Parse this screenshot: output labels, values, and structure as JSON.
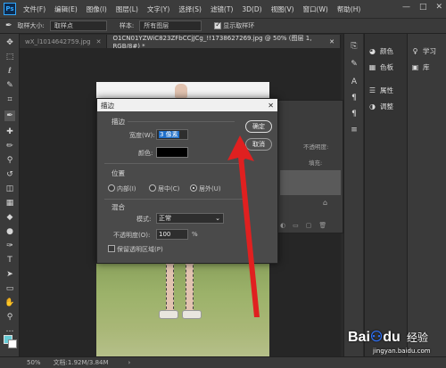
{
  "app": {
    "logo_text": "Ps"
  },
  "menubar": {
    "items": [
      "文件(F)",
      "编辑(E)",
      "图像(I)",
      "图层(L)",
      "文字(Y)",
      "选择(S)",
      "滤镜(T)",
      "3D(D)",
      "视图(V)",
      "窗口(W)",
      "帮助(H)"
    ],
    "window_buttons": [
      "—",
      "□",
      "✕"
    ]
  },
  "options_bar": {
    "sample_size_label": "取样大小:",
    "sample_size_value": "取样点",
    "sample_label": "样本:",
    "sample_value": "所有图层",
    "show_ring_label": "显示取样环"
  },
  "tabs": [
    {
      "label": "wX_l1014642759.jpg",
      "close": "✕",
      "active": false
    },
    {
      "label": "O1CN01YZWiC823ZFbCCjJCg_!!1738627269.jpg @ 50% (图层 1, RGB/8#) *",
      "close": "✕",
      "active": true
    }
  ],
  "dialog": {
    "title": "描边",
    "close": "✕",
    "stroke_group": "描边",
    "width_label": "宽度(W):",
    "width_value": "3 像素",
    "color_label": "颜色:",
    "color_value": "#000000",
    "position_group": "位置",
    "position_options": [
      "内部(I)",
      "居中(C)",
      "居外(U)"
    ],
    "position_selected": "居外(U)",
    "blend_group": "混合",
    "mode_label": "模式:",
    "mode_value": "正常",
    "opacity_label": "不透明度(O):",
    "opacity_value": "100",
    "opacity_unit": "%",
    "preserve_label": "保留透明区域(P)",
    "ok_button": "确定",
    "cancel_button": "取消"
  },
  "layers_panel": {
    "opacity_label": "不透明度:",
    "fill_label": "填充:"
  },
  "right_panel": {
    "items": [
      {
        "icon": "palette-icon",
        "label": "颜色"
      },
      {
        "icon": "swatches-icon",
        "label": "色板"
      },
      {
        "icon": "properties-icon",
        "label": "属性"
      },
      {
        "icon": "adjustments-icon",
        "label": "调整"
      }
    ],
    "far_items": [
      {
        "icon": "learn-icon",
        "label": "学习"
      },
      {
        "icon": "library-icon",
        "label": "库"
      }
    ]
  },
  "status": {
    "zoom": "50%",
    "doc_info": "文档:1.92M/3.84M"
  },
  "watermark": {
    "logo": "Bai",
    "logo2": "du",
    "cn": "经验",
    "url": "jingyan.baidu.com"
  },
  "colors": {
    "arrow": "#e02020",
    "accent_selection": "#1f6fc9"
  }
}
